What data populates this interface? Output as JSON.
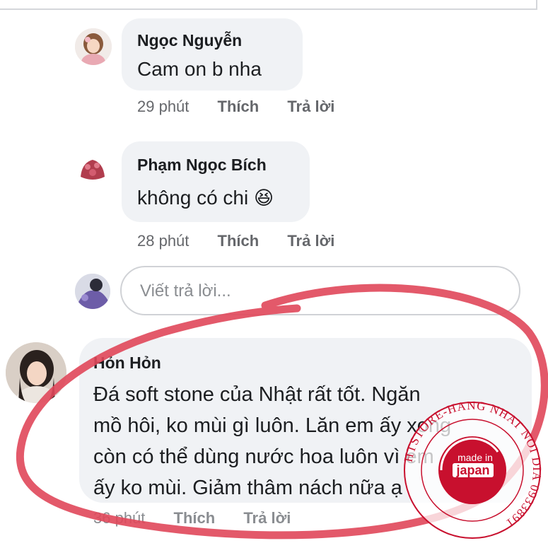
{
  "comments": [
    {
      "author": "Ngọc Nguyễn",
      "text": "Cam on b nha",
      "time": "29 phút",
      "like_label": "Thích",
      "reply_label": "Trả lời"
    },
    {
      "author": "Phạm Ngọc Bích",
      "text": "không có chi",
      "emoji": "😆",
      "time": "28 phút",
      "like_label": "Thích",
      "reply_label": "Trả lời"
    },
    {
      "author": "Hỏn Hỏn",
      "text_lines": [
        "Đá soft stone của Nhật rất tốt. Ngăn",
        "mồ hôi, ko mùi gì luôn. Lăn em ấy xong",
        "còn có thể dùng nước hoa luôn vì em",
        "ấy ko mùi. Giảm thâm nách nữa ạ"
      ],
      "time": "36 phút",
      "like_label": "Thích",
      "reply_label": "Trả lời"
    }
  ],
  "reply_box": {
    "placeholder": "Viết trả lời..."
  },
  "watermark": {
    "ring_text": "HTSTORE-HANG NHAT NOI DIA 0933891",
    "badge_line1": "made in",
    "badge_line2": "japan",
    "color": "#c8102e"
  },
  "annotation_color": "#e0475a",
  "colors": {
    "bubble": "#f0f2f5",
    "meta": "#65676b",
    "text": "#1c1e21"
  }
}
